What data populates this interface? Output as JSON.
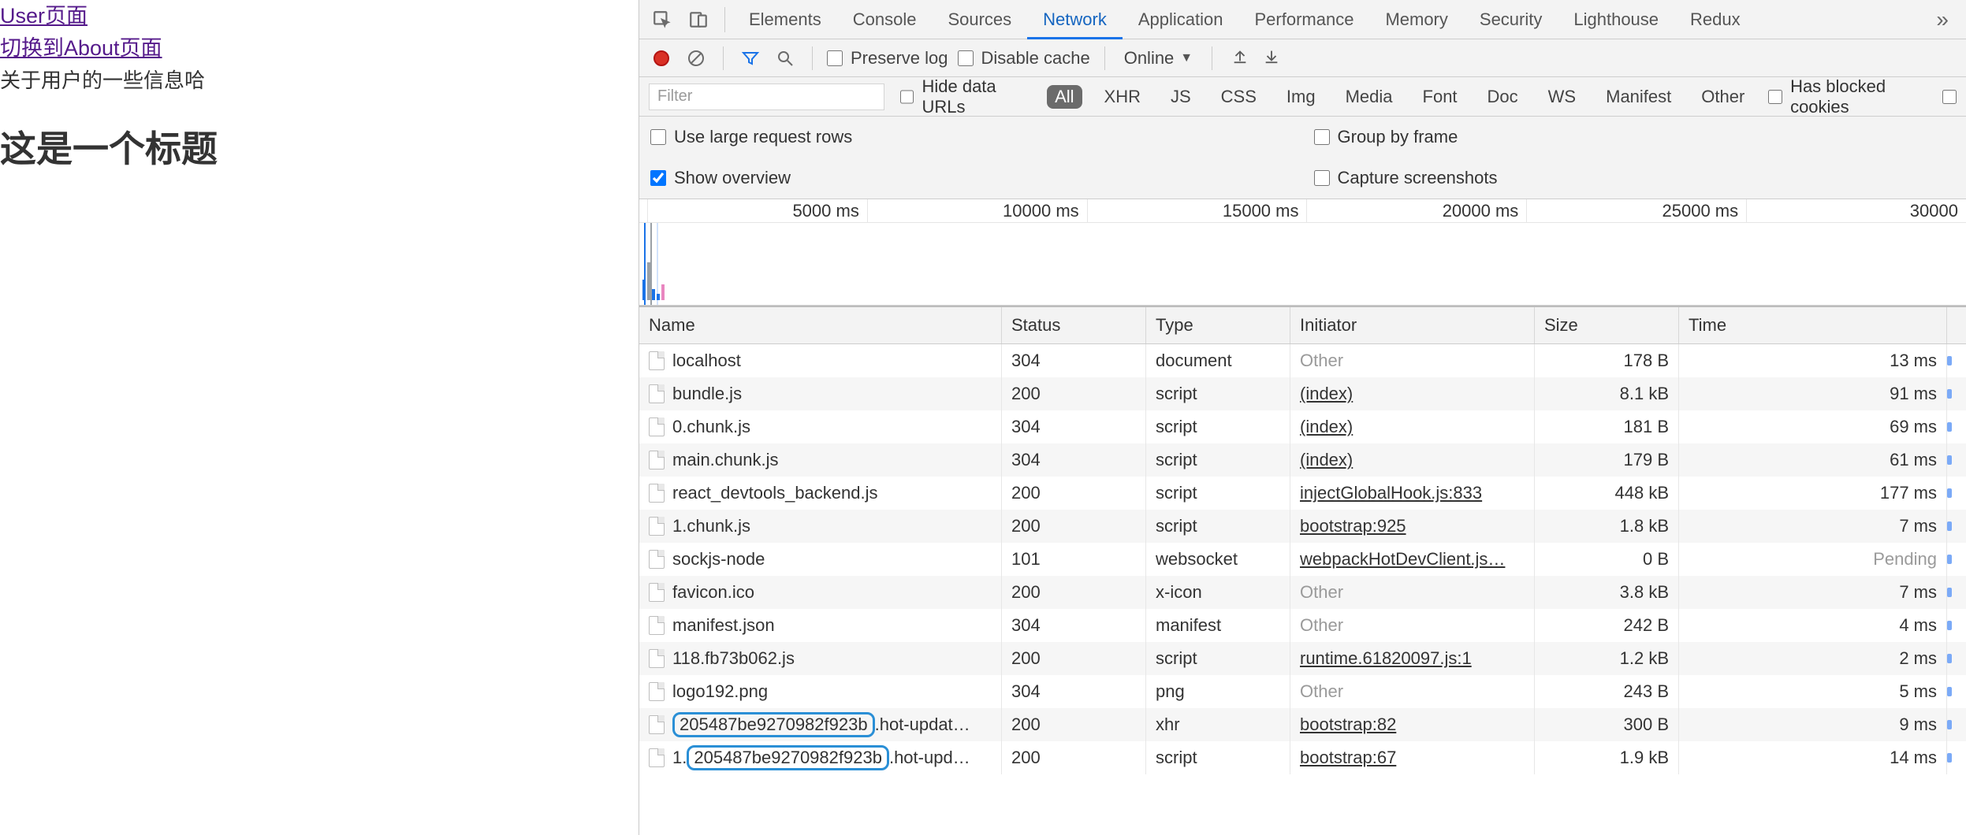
{
  "webpage": {
    "link1": "User页面",
    "link2": "切换到About页面",
    "info": "关于用户的一些信息哈",
    "heading": "这是一个标题"
  },
  "devtools": {
    "tabs": [
      "Elements",
      "Console",
      "Sources",
      "Network",
      "Application",
      "Performance",
      "Memory",
      "Security",
      "Lighthouse",
      "Redux"
    ],
    "active_tab": "Network",
    "toolbar": {
      "preserve_log": "Preserve log",
      "disable_cache": "Disable cache",
      "throttle": "Online"
    },
    "filterbar": {
      "placeholder": "Filter",
      "hide_urls": "Hide data URLs",
      "types": [
        "All",
        "XHR",
        "JS",
        "CSS",
        "Img",
        "Media",
        "Font",
        "Doc",
        "WS",
        "Manifest",
        "Other"
      ],
      "blocked": "Has blocked cookies"
    },
    "opts": {
      "large_rows": "Use large request rows",
      "group_frame": "Group by frame",
      "show_overview": "Show overview",
      "capture_ss": "Capture screenshots"
    },
    "timeline_ticks": [
      "5000 ms",
      "10000 ms",
      "15000 ms",
      "20000 ms",
      "25000 ms",
      "30000"
    ],
    "columns": [
      "Name",
      "Status",
      "Type",
      "Initiator",
      "Size",
      "Time"
    ],
    "rows": [
      {
        "name": "localhost",
        "status": "304",
        "type": "document",
        "initiator": "Other",
        "initiator_link": false,
        "size": "178 B",
        "time": "13 ms"
      },
      {
        "name": "bundle.js",
        "status": "200",
        "type": "script",
        "initiator": "(index)",
        "initiator_link": true,
        "size": "8.1 kB",
        "time": "91 ms"
      },
      {
        "name": "0.chunk.js",
        "status": "304",
        "type": "script",
        "initiator": "(index)",
        "initiator_link": true,
        "size": "181 B",
        "time": "69 ms"
      },
      {
        "name": "main.chunk.js",
        "status": "304",
        "type": "script",
        "initiator": "(index)",
        "initiator_link": true,
        "size": "179 B",
        "time": "61 ms"
      },
      {
        "name": "react_devtools_backend.js",
        "status": "200",
        "type": "script",
        "initiator": "injectGlobalHook.js:833",
        "initiator_link": true,
        "size": "448 kB",
        "time": "177 ms"
      },
      {
        "name": "1.chunk.js",
        "status": "200",
        "type": "script",
        "initiator": "bootstrap:925",
        "initiator_link": true,
        "size": "1.8 kB",
        "time": "7 ms"
      },
      {
        "name": "sockjs-node",
        "status": "101",
        "type": "websocket",
        "initiator": "webpackHotDevClient.js…",
        "initiator_link": true,
        "size": "0 B",
        "time": "Pending",
        "pending": true
      },
      {
        "name": "favicon.ico",
        "status": "200",
        "type": "x-icon",
        "initiator": "Other",
        "initiator_link": false,
        "size": "3.8 kB",
        "time": "7 ms"
      },
      {
        "name": "manifest.json",
        "status": "304",
        "type": "manifest",
        "initiator": "Other",
        "initiator_link": false,
        "size": "242 B",
        "time": "4 ms"
      },
      {
        "name": "118.fb73b062.js",
        "status": "200",
        "type": "script",
        "initiator": "runtime.61820097.js:1",
        "initiator_link": true,
        "size": "1.2 kB",
        "time": "2 ms"
      },
      {
        "name": "logo192.png",
        "status": "304",
        "type": "png",
        "initiator": "Other",
        "initiator_link": false,
        "size": "243 B",
        "time": "5 ms"
      },
      {
        "name": "205487be9270982f923b.hot-updat…",
        "hl": "205487be9270982f923b",
        "tail": ".hot-updat…",
        "status": "200",
        "type": "xhr",
        "initiator": "bootstrap:82",
        "initiator_link": true,
        "size": "300 B",
        "time": "9 ms"
      },
      {
        "name": "1.205487be9270982f923b.hot-upd…",
        "pre": "1.",
        "hl": "205487be9270982f923b",
        "tail": ".hot-upd…",
        "status": "200",
        "type": "script",
        "initiator": "bootstrap:67",
        "initiator_link": true,
        "size": "1.9 kB",
        "time": "14 ms"
      }
    ]
  }
}
